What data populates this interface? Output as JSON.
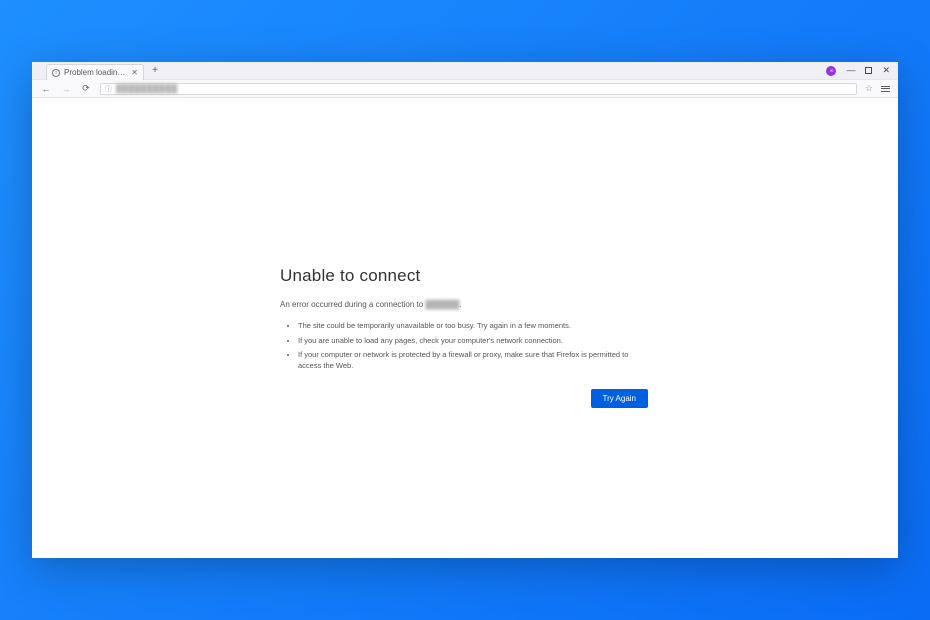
{
  "window": {
    "profile_initials": "∞",
    "minimize_glyph": "—",
    "close_glyph": "✕"
  },
  "tab": {
    "title": "Problem loading page",
    "close_glyph": "✕",
    "newtab_glyph": "+"
  },
  "toolbar": {
    "back_glyph": "←",
    "forward_glyph": "→",
    "reload_glyph": "⟳",
    "lock_glyph": "ⓘ",
    "url_obscured": "██████████",
    "star_glyph": "☆"
  },
  "error": {
    "title": "Unable to connect",
    "subtext_prefix": "An error occurred during a connection to ",
    "subtext_host_obscured": "██████",
    "subtext_suffix": ".",
    "bullets": [
      "The site could be temporarily unavailable or too busy. Try again in a few moments.",
      "If you are unable to load any pages, check your computer's network connection.",
      "If your computer or network is protected by a firewall or proxy, make sure that Firefox is permitted to access the Web."
    ],
    "button_label": "Try Again"
  }
}
